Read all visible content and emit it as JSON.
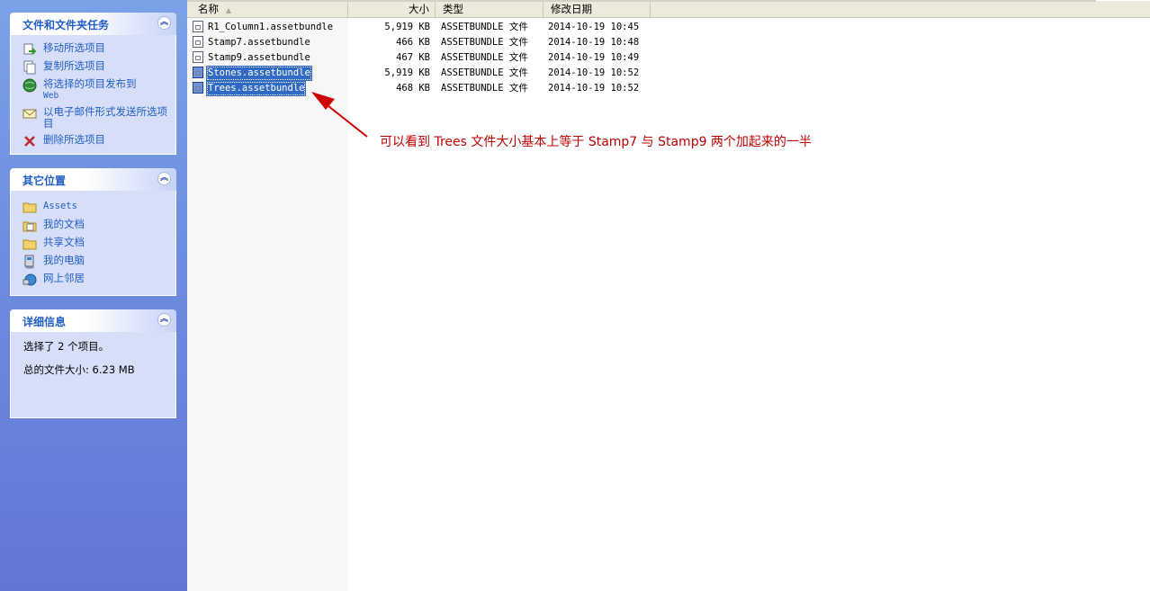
{
  "task_pane": {
    "file_tasks": {
      "title": "文件和文件夹任务",
      "items": [
        {
          "label": "移动所选项目",
          "icon": "move-icon"
        },
        {
          "label": "复制所选项目",
          "icon": "copy-icon"
        },
        {
          "label": "将选择的项目发布到",
          "sublabel": "Web",
          "icon": "publish-web-icon"
        },
        {
          "label": "以电子邮件形式发送所选项目",
          "icon": "email-icon"
        },
        {
          "label": "删除所选项目",
          "icon": "delete-icon"
        }
      ]
    },
    "other_places": {
      "title": "其它位置",
      "items": [
        {
          "label": "Assets",
          "icon": "folder-icon"
        },
        {
          "label": "我的文档",
          "icon": "my-documents-icon"
        },
        {
          "label": "共享文档",
          "icon": "shared-folder-icon"
        },
        {
          "label": "我的电脑",
          "icon": "my-computer-icon"
        },
        {
          "label": "网上邻居",
          "icon": "network-icon"
        }
      ]
    },
    "details": {
      "title": "详细信息",
      "selected": "选择了 2 个项目。",
      "total_size": "总的文件大小: 6.23 MB"
    },
    "collapse_glyph": "︽"
  },
  "file_list": {
    "columns": {
      "name": "名称",
      "size": "大小",
      "type": "类型",
      "modified": "修改日期"
    },
    "sort_indicator": "▲",
    "files": [
      {
        "name": "R1_Column1.assetbundle",
        "size": "5,919 KB",
        "type": "ASSETBUNDLE 文件",
        "modified": "2014-10-19 10:45",
        "selected": false
      },
      {
        "name": "Stamp7.assetbundle",
        "size": "466 KB",
        "type": "ASSETBUNDLE 文件",
        "modified": "2014-10-19 10:48",
        "selected": false
      },
      {
        "name": "Stamp9.assetbundle",
        "size": "467 KB",
        "type": "ASSETBUNDLE 文件",
        "modified": "2014-10-19 10:49",
        "selected": false
      },
      {
        "name": "Stones.assetbundle",
        "size": "5,919 KB",
        "type": "ASSETBUNDLE 文件",
        "modified": "2014-10-19 10:52",
        "selected": true
      },
      {
        "name": "Trees.assetbundle",
        "size": "468 KB",
        "type": "ASSETBUNDLE 文件",
        "modified": "2014-10-19 10:52",
        "selected": true
      }
    ]
  },
  "annotation": {
    "text": "可以看到 Trees 文件大小基本上等于 Stamp7 与 Stamp9 两个加起来的一半",
    "color": "#c00000"
  },
  "colors": {
    "selection": "#316ac5",
    "task_link": "#215dc6",
    "panel_body": "#d6dff7"
  }
}
